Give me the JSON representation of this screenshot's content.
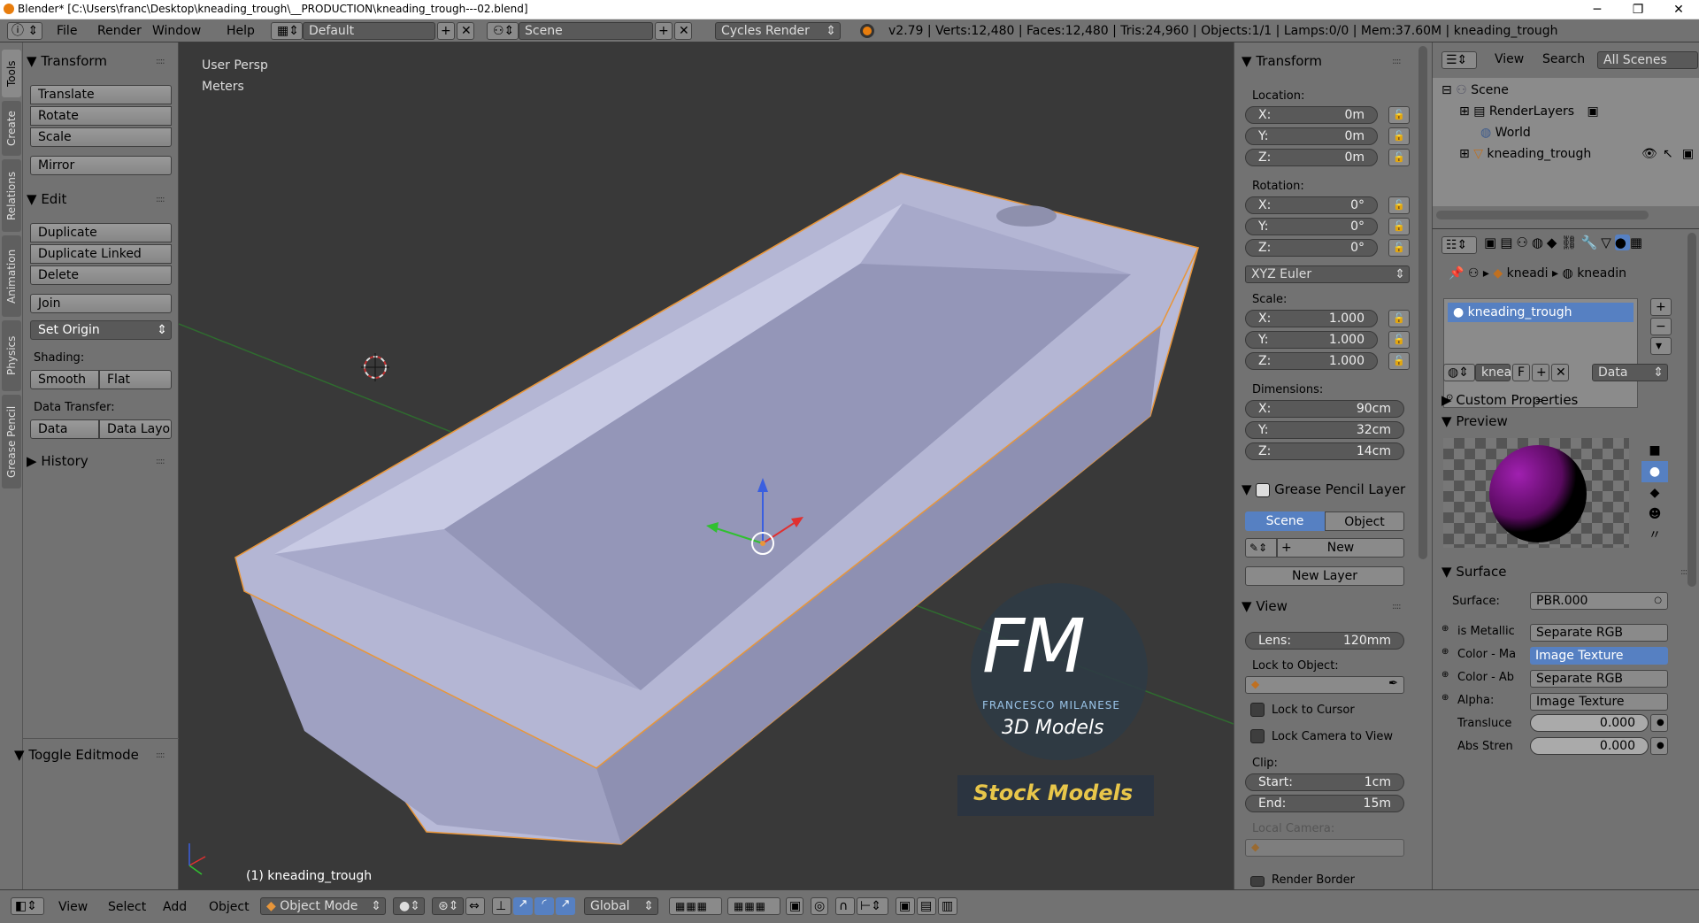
{
  "window": {
    "title": "Blender* [C:\\Users\\franc\\Desktop\\kneading_trough\\__PRODUCTION\\kneading_trough---02.blend]",
    "minimize": "─",
    "maximize": "❐",
    "close": "✕"
  },
  "infobar": {
    "menus": [
      "File",
      "Render",
      "Window",
      "Help"
    ],
    "layout": "Default",
    "scene": "Scene",
    "engine": "Cycles Render",
    "stats": "v2.79 | Verts:12,480 | Faces:12,480 | Tris:24,960 | Objects:1/1 | Lamps:0/0 | Mem:37.60M | kneading_trough"
  },
  "left_tabs": [
    "Tools",
    "Create",
    "Relations",
    "Animation",
    "Physics",
    "Grease Pencil"
  ],
  "toolshelf": {
    "transform_header": "Transform",
    "transform_buttons": [
      "Translate",
      "Rotate",
      "Scale"
    ],
    "mirror": "Mirror",
    "edit_header": "Edit",
    "edit_buttons": [
      "Duplicate",
      "Duplicate Linked",
      "Delete"
    ],
    "join": "Join",
    "set_origin": "Set Origin",
    "shading_label": "Shading:",
    "smooth": "Smooth",
    "flat": "Flat",
    "data_transfer_label": "Data Transfer:",
    "data": "Data",
    "data_layout": "Data Layo",
    "history": "History",
    "toggle_editmode": "Toggle Editmode"
  },
  "viewport": {
    "view_name": "User Persp",
    "units": "Meters",
    "object_label": "(1) kneading_trough",
    "logo_letters": "FM",
    "logo_name": "FRANCESCO MILANESE",
    "logo_sub": "3D Models",
    "banner": "Stock Models"
  },
  "n_panel": {
    "transform_header": "Transform",
    "location_label": "Location:",
    "location": [
      {
        "k": "X:",
        "v": "0m"
      },
      {
        "k": "Y:",
        "v": "0m"
      },
      {
        "k": "Z:",
        "v": "0m"
      }
    ],
    "rotation_label": "Rotation:",
    "rotation": [
      {
        "k": "X:",
        "v": "0°"
      },
      {
        "k": "Y:",
        "v": "0°"
      },
      {
        "k": "Z:",
        "v": "0°"
      }
    ],
    "rotation_mode": "XYZ Euler",
    "scale_label": "Scale:",
    "scale": [
      {
        "k": "X:",
        "v": "1.000"
      },
      {
        "k": "Y:",
        "v": "1.000"
      },
      {
        "k": "Z:",
        "v": "1.000"
      }
    ],
    "dimensions_label": "Dimensions:",
    "dimensions": [
      {
        "k": "X:",
        "v": "90cm"
      },
      {
        "k": "Y:",
        "v": "32cm"
      },
      {
        "k": "Z:",
        "v": "14cm"
      }
    ],
    "gp_header": "Grease Pencil Layer",
    "gp_scene": "Scene",
    "gp_object": "Object",
    "gp_new": "New",
    "gp_new_layer": "New Layer",
    "view_header": "View",
    "lens_label": "Lens:",
    "lens_value": "120mm",
    "lock_to_object": "Lock to Object:",
    "lock_to_cursor": "Lock to Cursor",
    "lock_camera": "Lock Camera to View",
    "clip_label": "Clip:",
    "clip_start_label": "Start:",
    "clip_start": "1cm",
    "clip_end_label": "End:",
    "clip_end": "15m",
    "local_camera": "Local Camera:",
    "render_border": "Render Border"
  },
  "outliner": {
    "view": "View",
    "search": "Search",
    "filter": "All Scenes",
    "items": [
      "Scene",
      "RenderLayers",
      "World",
      "kneading_trough"
    ]
  },
  "properties": {
    "breadcrumb1": "kneadi",
    "breadcrumb2": "kneadin",
    "material_slot": "kneading_trough",
    "datablock": "knea",
    "fake_user": "F",
    "link": "Data",
    "custom_props": "Custom Properties",
    "preview": "Preview",
    "surface_header": "Surface",
    "surface_label": "Surface:",
    "surface_value": "PBR.000",
    "inputs": [
      {
        "label": "is Metallic",
        "value": "Separate RGB",
        "active": false
      },
      {
        "label": "Color - Ma",
        "value": "Image Texture",
        "active": true
      },
      {
        "label": "Color - Ab",
        "value": "Separate RGB",
        "active": false
      },
      {
        "label": "Alpha:",
        "value": "Image Texture",
        "active": false
      }
    ],
    "translucence_label": "Transluce",
    "translucence_value": "0.000",
    "abs_label": "Abs Stren",
    "abs_value": "0.000"
  },
  "bottombar": {
    "menus": [
      "View",
      "Select",
      "Add",
      "Object"
    ],
    "mode": "Object Mode",
    "orientation": "Global"
  },
  "colors": {
    "panel": "#727272",
    "viewport": "#393939",
    "mesh": "#a6a8c8",
    "selection_outline": "#e8963a",
    "highlight": "#5680c2"
  }
}
